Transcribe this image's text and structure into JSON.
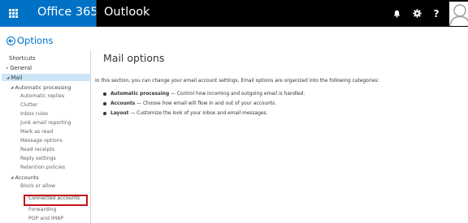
{
  "topbar": {
    "suite_name": "Office 365",
    "app_name": "Outlook",
    "icons": [
      "app-launcher-icon",
      "bell-icon",
      "gear-icon",
      "help-icon",
      "avatar-icon"
    ],
    "help_label": "?",
    "colors": {
      "bar": "#000000",
      "brand": "#0072c6"
    }
  },
  "header": {
    "back_title": "Options"
  },
  "nav": {
    "shortcuts": "Shortcuts",
    "general": "General",
    "mail": "Mail",
    "automatic_processing": "Automatic processing",
    "automatic_processing_items": [
      "Automatic replies",
      "Clutter",
      "Inbox rules",
      "Junk email reporting",
      "Mark as read",
      "Message options",
      "Read receipts",
      "Reply settings",
      "Retention policies"
    ],
    "accounts": "Accounts",
    "accounts_items": [
      "Block or allow",
      "Connected accounts",
      "Forwarding",
      "POP and IMAP"
    ],
    "highlight_color": "#c4131a",
    "selected_color": "#cde6f7"
  },
  "main": {
    "title": "Mail options",
    "intro": "In this section, you can change your email account settings. Email options are organized into the following categories:",
    "bullets": [
      {
        "term": "Automatic processing",
        "desc": " — Control how incoming and outgoing email is handled."
      },
      {
        "term": "Accounts",
        "desc": " — Choose how email will flow in and out of your accounts."
      },
      {
        "term": "Layout",
        "desc": " — Customize the look of your inbox and email messages."
      }
    ]
  }
}
